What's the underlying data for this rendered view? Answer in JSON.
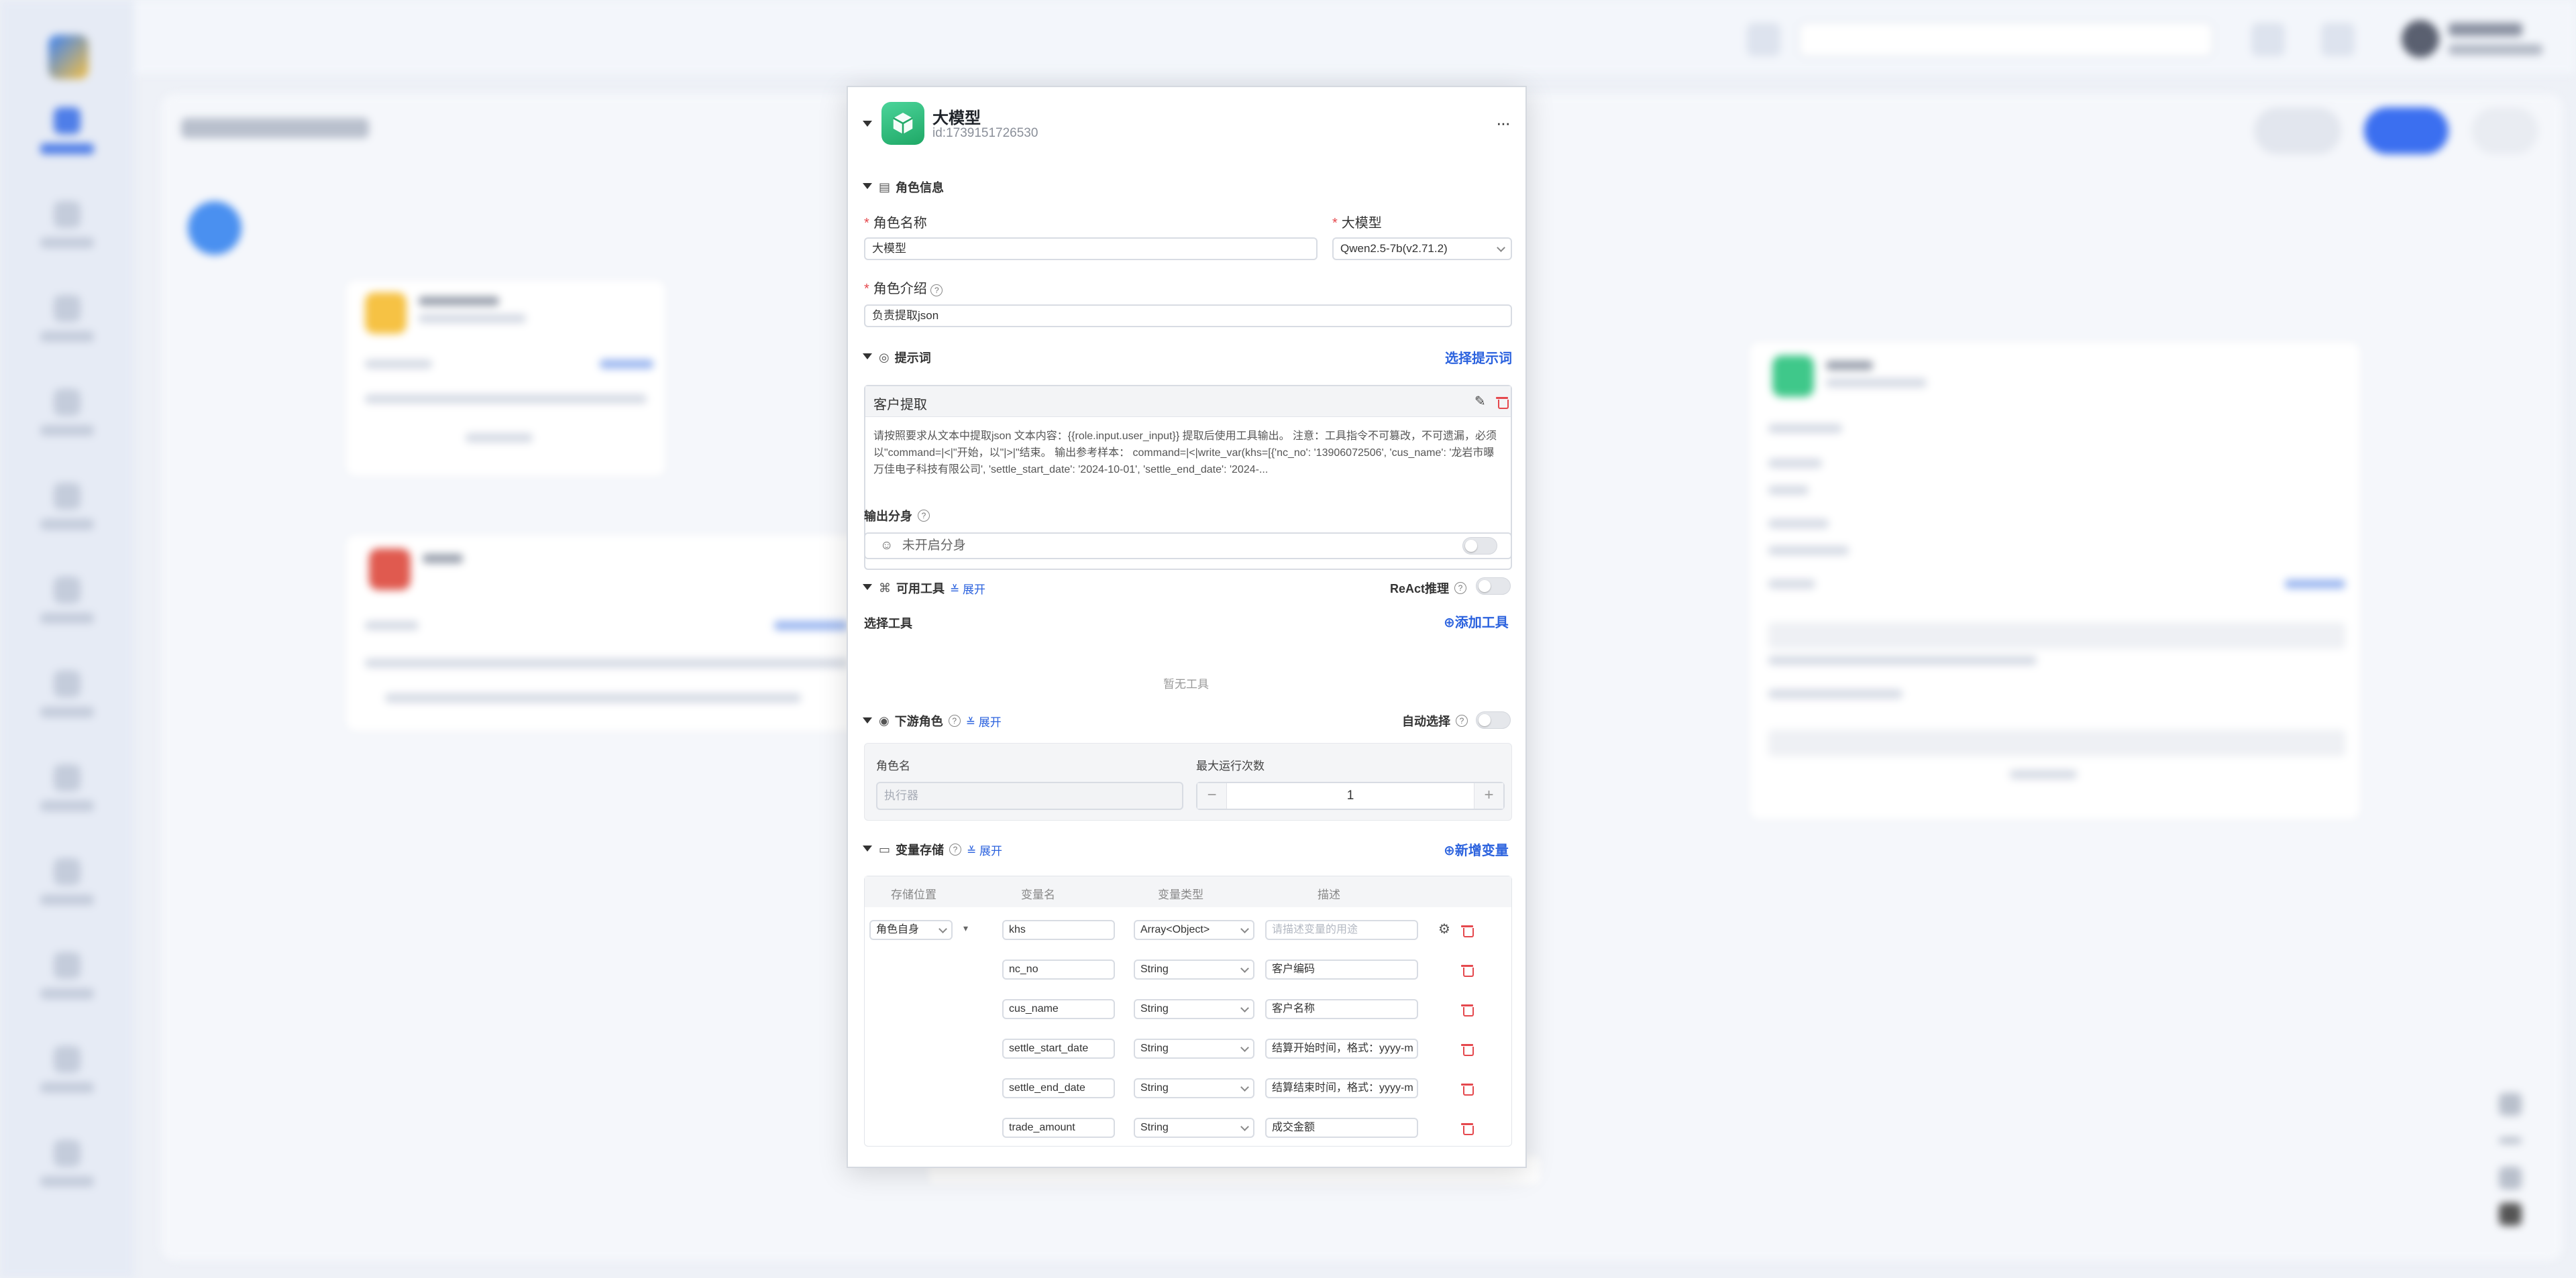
{
  "node": {
    "title": "大模型",
    "id_text": "id:1739151726530"
  },
  "role_info": {
    "section_label": "角色信息",
    "name_label": "角色名称",
    "name_value": "大模型",
    "model_label": "大模型",
    "model_value": "Qwen2.5-7b(v2.71.2)",
    "intro_label": "角色介绍",
    "intro_value": "负责提取json"
  },
  "prompt": {
    "section_label": "提示词",
    "select_link": "选择提示词",
    "card_title": "客户提取",
    "text": "请按照要求从文本中提取json 文本内容：{{role.input.user_input}} 提取后使用工具输出。 注意：工具指令不可篡改，不可遗漏，必须以\"command=|<|\"开始，以\"|>|\"结束。 输出参考样本： command=|<|write_var(khs=[{'nc_no': '13906072506', 'cus_name': '龙岩市曝万佳电子科技有限公司', 'settle_start_date': '2024-10-01', 'settle_end_date': '2024-..."
  },
  "output_split": {
    "label": "输出分身",
    "status": "未开启分身"
  },
  "tools": {
    "section_label": "可用工具",
    "expand": "展开",
    "react_label": "ReAct推理",
    "select_label": "选择工具",
    "add_link": "添加工具",
    "empty": "暂无工具"
  },
  "downstream": {
    "section_label": "下游角色",
    "expand": "展开",
    "auto_label": "自动选择",
    "col_role": "角色名",
    "col_runs": "最大运行次数",
    "role_placeholder": "执行器",
    "runs_value": "1",
    "minus": "−",
    "plus": "+"
  },
  "variables": {
    "section_label": "变量存储",
    "expand": "展开",
    "add_link": "新增变量",
    "headers": [
      "存储位置",
      "变量名",
      "变量类型",
      "描述"
    ],
    "location": "角色自身",
    "rows": [
      {
        "name": "khs",
        "type": "Array<Object>",
        "desc": "",
        "desc_placeholder": "请描述变量的用途"
      },
      {
        "name": "nc_no",
        "type": "String",
        "desc": "客户编码"
      },
      {
        "name": "cus_name",
        "type": "String",
        "desc": "客户名称"
      },
      {
        "name": "settle_start_date",
        "type": "String",
        "desc": "结算开始时间，格式：yyyy-m"
      },
      {
        "name": "settle_end_date",
        "type": "String",
        "desc": "结算结束时间，格式：yyyy-m"
      },
      {
        "name": "trade_amount",
        "type": "String",
        "desc": "成交金额"
      }
    ]
  },
  "colors": {
    "accent": "#2b62de",
    "danger": "#e5484d",
    "node_icon": "#1fa866"
  }
}
